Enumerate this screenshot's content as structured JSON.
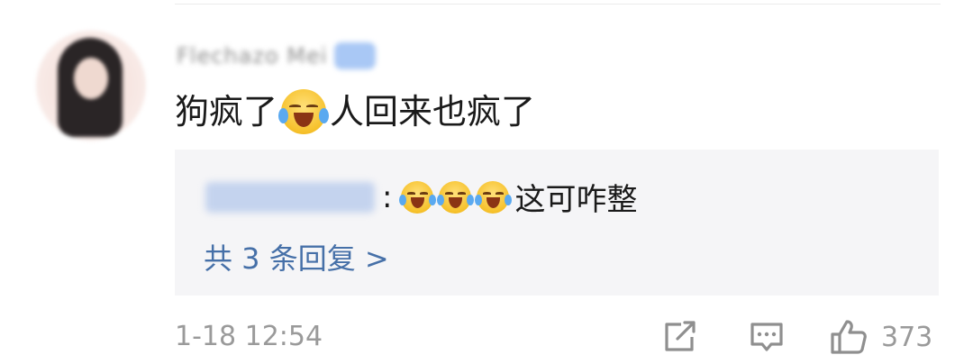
{
  "comment": {
    "username": "Flechazo Mei",
    "text_before_emoji": "狗疯了",
    "emoji": "laughing-crying-emoji",
    "text_after_emoji": "人回来也疯了",
    "timestamp": "1-18 12:54",
    "like_count": "373"
  },
  "reply_preview": {
    "colon": ":",
    "emoji_count": 3,
    "text": "这可咋整",
    "more_replies_label": "共 3 条回复 >"
  },
  "icons": {
    "share": "share-icon",
    "comment": "comment-icon",
    "like": "thumbs-up-icon"
  },
  "colors": {
    "link_blue": "#4670a8",
    "meta_gray": "#9a9a9a",
    "reply_bg": "#f5f5f7"
  }
}
